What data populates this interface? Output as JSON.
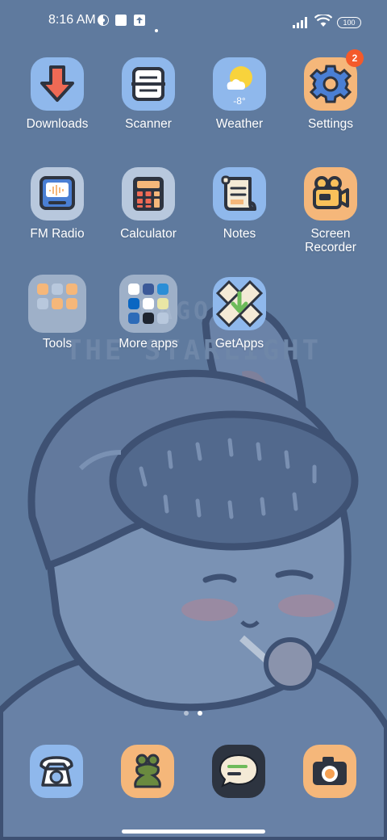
{
  "status_bar": {
    "time": "8:16 AM",
    "battery": "100",
    "left_icons": [
      "screen-record-icon",
      "notification-square-icon",
      "upload-icon",
      "dot-icon"
    ],
    "right_icons": [
      "signal-icon",
      "wifi-icon",
      "battery-icon"
    ]
  },
  "wallpaper": {
    "line1": "WAGONS",
    "line2": "THE STARLIGHT"
  },
  "apps": [
    {
      "label": "Downloads",
      "icon": "download-arrow-icon",
      "bg": "#8fb8ec"
    },
    {
      "label": "Scanner",
      "icon": "scanner-icon",
      "bg": "#8fb8ec"
    },
    {
      "label": "Weather",
      "icon": "weather-sun-cloud-icon",
      "bg": "#8fb8ec",
      "temp": "-8°"
    },
    {
      "label": "Settings",
      "icon": "gear-icon",
      "bg": "#f5b77a",
      "badge": "2"
    },
    {
      "label": "FM Radio",
      "icon": "radio-icon",
      "bg": "#b8c8dd"
    },
    {
      "label": "Calculator",
      "icon": "calculator-icon",
      "bg": "#b8c8dd"
    },
    {
      "label": "Notes",
      "icon": "notes-scroll-icon",
      "bg": "#8fb8ec"
    },
    {
      "label": "Screen\nRecorder",
      "icon": "camcorder-icon",
      "bg": "#f5b77a"
    },
    {
      "label": "Tools",
      "icon": "folder-icon",
      "bg": "folder"
    },
    {
      "label": "More apps",
      "icon": "folder-icon",
      "bg": "folder"
    },
    {
      "label": "GetApps",
      "icon": "getapps-icon",
      "bg": "#8fb8ec"
    }
  ],
  "dock": [
    {
      "name": "phone",
      "icon": "phone-icon",
      "bg": "#8fb8ec"
    },
    {
      "name": "messages-frog",
      "icon": "frog-icon",
      "bg": "#f5b77a"
    },
    {
      "name": "messages",
      "icon": "chat-bubble-icon",
      "bg": "#2d3440"
    },
    {
      "name": "camera",
      "icon": "camera-icon",
      "bg": "#f5b77a"
    }
  ],
  "pages": {
    "count": 2,
    "current": 2
  }
}
